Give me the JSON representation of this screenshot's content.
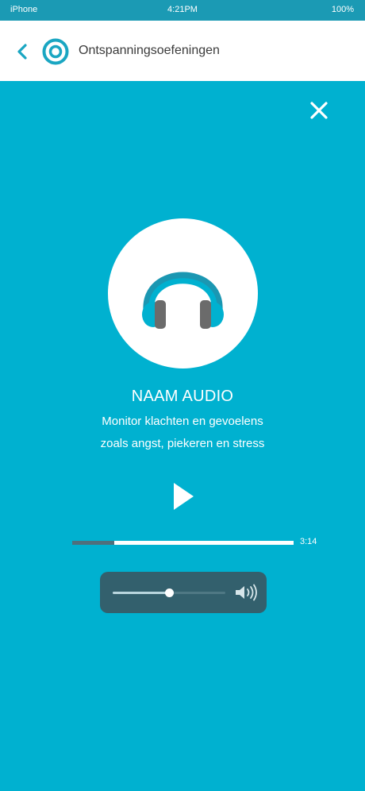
{
  "status_bar": {
    "carrier": "iPhone",
    "time": "4:21PM",
    "battery": "100%"
  },
  "nav": {
    "back_icon": "chevron-left-icon",
    "logo_icon": "concentric-circle-logo",
    "title": "Ontspanningsoefeningen"
  },
  "player": {
    "close_icon": "close-icon",
    "artwork_icon": "headphones-icon",
    "title": "NAAM AUDIO",
    "description_line1": "Monitor klachten en gevoelens",
    "description_line2": "zoals angst, piekeren en stress",
    "play_icon": "play-icon",
    "progress_fraction": 0.19,
    "duration": "3:14",
    "volume_fraction": 0.5,
    "volume_icon": "speaker-icon"
  },
  "colors": {
    "accent": "#00b1d0",
    "status_bar": "#1b9ab4",
    "volume_panel": "#33606d"
  }
}
